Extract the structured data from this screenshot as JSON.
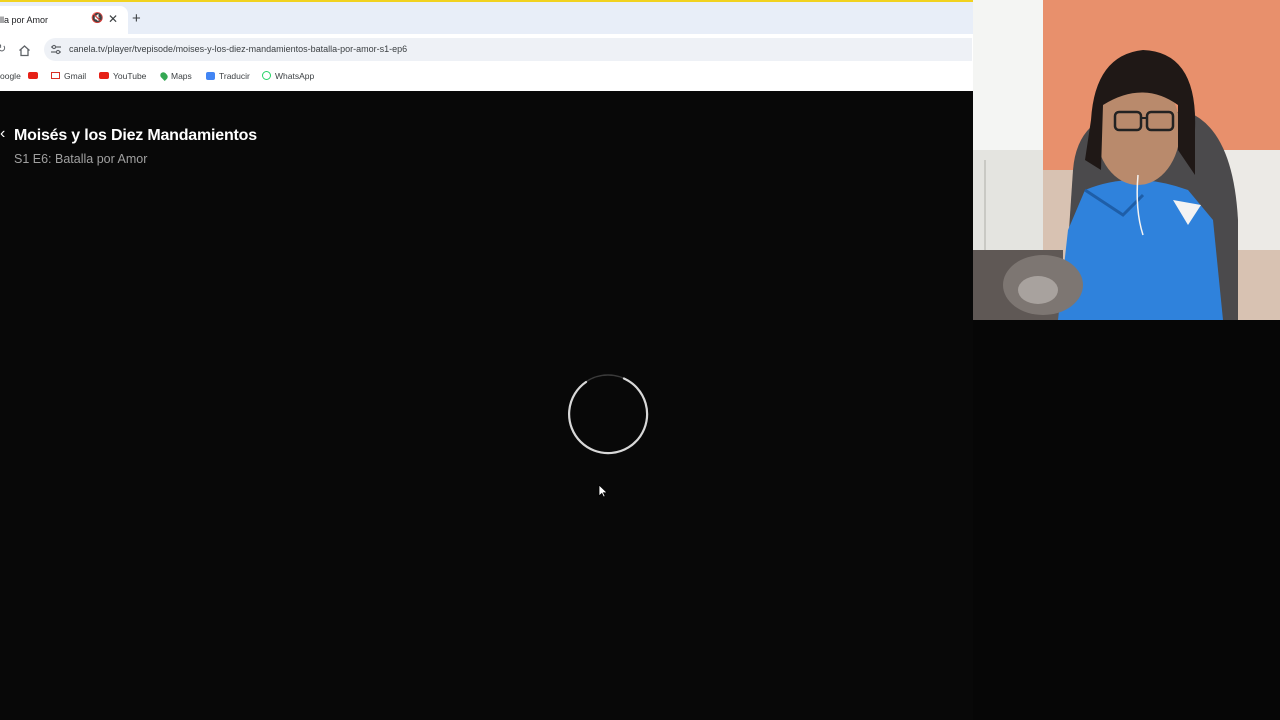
{
  "browser": {
    "tab": {
      "title": "lla por Amor",
      "mute_icon": "🔇",
      "close_icon": "✕"
    },
    "new_tab_icon": "+",
    "toolbar": {
      "reload_icon": "↻",
      "url": "canela.tv/player/tvepisode/moises-y-los-diez-mandamientos-batalla-por-amor-s1-ep6"
    },
    "bookmarks": [
      {
        "label": "oogle",
        "icon": "google-icon"
      },
      {
        "label": "",
        "icon": "youtube-icon"
      },
      {
        "label": "Gmail",
        "icon": "gmail-icon"
      },
      {
        "label": "YouTube",
        "icon": "youtube-icon"
      },
      {
        "label": "Maps",
        "icon": "maps-icon"
      },
      {
        "label": "Traducir",
        "icon": "translate-icon"
      },
      {
        "label": "WhatsApp",
        "icon": "whatsapp-icon"
      }
    ]
  },
  "player": {
    "back_glyph": "‹",
    "show_title": "Moisés y los Diez Mandamientos",
    "episode": "S1 E6: Batalla por Amor",
    "state": "loading"
  },
  "colors": {
    "tab_strip_accent": "#f1d21f",
    "player_bg": "#080808",
    "spinner": "#d8d8d8"
  }
}
